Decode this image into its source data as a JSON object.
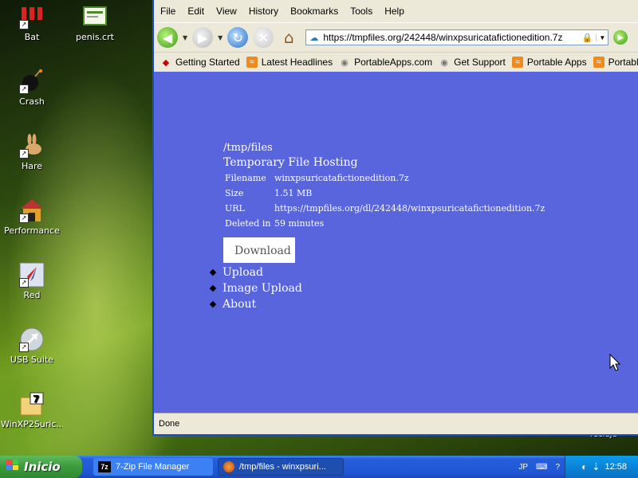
{
  "desktop": {
    "icons": [
      {
        "label": "Bat",
        "icon": "battery-icon"
      },
      {
        "label": "penis.crt",
        "icon": "certificate-icon"
      },
      {
        "label": "Crash",
        "icon": "bomb-icon"
      },
      {
        "label": "Hare",
        "icon": "rabbit-icon"
      },
      {
        "label": "Performance",
        "icon": "doghouse-icon"
      },
      {
        "label": "Red",
        "icon": "rocket-icon"
      },
      {
        "label": "USB Suite",
        "icon": "usb-arrow-icon"
      },
      {
        "label": "WinXP2Suric...",
        "icon": "7zip-archive-icon"
      }
    ],
    "partial_text": "recluje"
  },
  "browser": {
    "menu": [
      "File",
      "Edit",
      "View",
      "History",
      "Bookmarks",
      "Tools",
      "Help"
    ],
    "url": "https://tmpfiles.org/242448/winxpsuricatafictionedition.7z",
    "bookmarks": [
      {
        "label": "Getting Started",
        "icon": "redhat-icon"
      },
      {
        "label": "Latest Headlines",
        "icon": "rss-icon"
      },
      {
        "label": "PortableApps.com",
        "icon": "globe-icon"
      },
      {
        "label": "Get Support",
        "icon": "globe-icon"
      },
      {
        "label": "Portable Apps",
        "icon": "rss-icon"
      },
      {
        "label": "Portable Apps News",
        "icon": "rss-icon"
      }
    ],
    "status": "Done"
  },
  "page": {
    "site_title": "/tmp/files",
    "site_subtitle": "Temporary File Hosting",
    "file_info": [
      {
        "key": "Filename",
        "value": "winxpsuricatafictionedition.7z"
      },
      {
        "key": "Size",
        "value": "1.51 MB"
      },
      {
        "key": "URL",
        "value": "https://tmpfiles.org/dl/242448/winxpsuricatafictionedition.7z"
      },
      {
        "key": "Deleted in",
        "value": "59 minutes"
      }
    ],
    "download_label": "Download",
    "nav": [
      "Upload",
      "Image Upload",
      "About"
    ]
  },
  "taskbar": {
    "start_label": "Inicio",
    "tasks": [
      {
        "label": "7-Zip File Manager",
        "icon": "7zip-icon"
      },
      {
        "label": "/tmp/files - winxpsuri...",
        "icon": "firefox-icon"
      }
    ],
    "language": "JP",
    "clock": "12:58"
  },
  "colors": {
    "page_background": "#5865dd",
    "taskbar_blue": "#245edb",
    "start_green": "#3c9a3c",
    "tray_blue": "#0a84d8"
  }
}
